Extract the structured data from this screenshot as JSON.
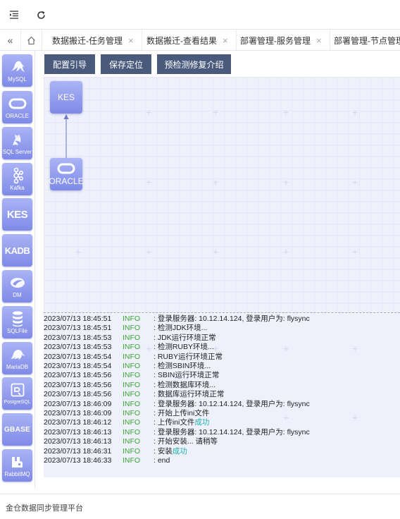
{
  "toolbar": {
    "collapse_icon": "indent-icon",
    "refresh_icon": "refresh-icon"
  },
  "tabs": [
    {
      "label": "数据搬迁-任务管理",
      "close": "×"
    },
    {
      "label": "数据搬迁-查看结果",
      "close": "×"
    },
    {
      "label": "部署管理-服务管理",
      "close": "×"
    },
    {
      "label": "部署管理-节点管理",
      "close": ""
    }
  ],
  "palette": [
    {
      "label": "MySQL",
      "icon": "dolphin-icon"
    },
    {
      "label": "ORACLE",
      "icon": "oracle-ring-icon"
    },
    {
      "label": "SQL Server",
      "icon": "sqlserver-icon"
    },
    {
      "label": "Kafka",
      "icon": "kafka-icon"
    },
    {
      "label": "",
      "text": "KES"
    },
    {
      "label": "",
      "text": "KADB"
    },
    {
      "label": "DM",
      "icon": "dm-icon"
    },
    {
      "label": "SQLFile",
      "icon": "database-stack-icon"
    },
    {
      "label": "MariaDB",
      "icon": "seal-icon"
    },
    {
      "label": "PostgreSQL",
      "icon": "postgres-icon"
    },
    {
      "label": "",
      "text": "GBASE"
    },
    {
      "label": "RabbitMQ",
      "icon": "rabbitmq-icon"
    }
  ],
  "actions": {
    "config_guide": "配置引导",
    "save_position": "保存定位",
    "precheck_intro": "预检测修复介绍"
  },
  "canvas": {
    "nodes": [
      {
        "text": "KES",
        "label": ""
      },
      {
        "text": "",
        "label": "ORACLE"
      }
    ]
  },
  "logs": [
    {
      "ts": "2023/07/13 18:45:51",
      "level": "INFO",
      "msg": ": 登录服务器: 10.12.14.124, 登录用户为: flysync",
      "ok": ""
    },
    {
      "ts": "2023/07/13 18:45:51",
      "level": "INFO",
      "msg": ": 检测JDK环境...",
      "ok": ""
    },
    {
      "ts": "2023/07/13 18:45:53",
      "level": "INFO",
      "msg": ": JDK运行环境正常",
      "ok": ""
    },
    {
      "ts": "2023/07/13 18:45:53",
      "level": "INFO",
      "msg": ": 检测RUBY环境...",
      "ok": ""
    },
    {
      "ts": "2023/07/13 18:45:54",
      "level": "INFO",
      "msg": ": RUBY运行环境正常",
      "ok": ""
    },
    {
      "ts": "2023/07/13 18:45:54",
      "level": "INFO",
      "msg": ": 检测SBIN环境...",
      "ok": ""
    },
    {
      "ts": "2023/07/13 18:45:56",
      "level": "INFO",
      "msg": ": SBIN运行环境正常",
      "ok": ""
    },
    {
      "ts": "2023/07/13 18:45:56",
      "level": "INFO",
      "msg": ": 检测数据库环境...",
      "ok": ""
    },
    {
      "ts": "2023/07/13 18:45:56",
      "level": "INFO",
      "msg": ": 数据库运行环境正常",
      "ok": ""
    },
    {
      "ts": "2023/07/13 18:46:09",
      "level": "INFO",
      "msg": ": 登录服务器: 10.12.14.124, 登录用户为: flysync",
      "ok": ""
    },
    {
      "ts": "2023/07/13 18:46:09",
      "level": "INFO",
      "msg": ": 开始上传ini文件",
      "ok": ""
    },
    {
      "ts": "2023/07/13 18:46:12",
      "level": "INFO",
      "msg": ": 上传ini文件",
      "ok": "成功"
    },
    {
      "ts": "2023/07/13 18:46:13",
      "level": "INFO",
      "msg": ": 登录服务器: 10.12.14.124, 登录用户为: flysync",
      "ok": ""
    },
    {
      "ts": "2023/07/13 18:46:13",
      "level": "INFO",
      "msg": ": 开始安装... 请稍等",
      "ok": ""
    },
    {
      "ts": "2023/07/13 18:46:31",
      "level": "INFO",
      "msg": ": 安装",
      "ok": "成功"
    },
    {
      "ts": "2023/07/13 18:46:33",
      "level": "INFO",
      "msg": ": end",
      "ok": ""
    }
  ],
  "footer": {
    "text": "金仓数据同步管理平台"
  },
  "colors": {
    "button_bg": "#4a5a7c",
    "node_gradient_top": "#aab4f5",
    "node_gradient_bottom": "#7f8ae8",
    "info_green": "#3aa535",
    "success_teal": "#20b2aa"
  }
}
